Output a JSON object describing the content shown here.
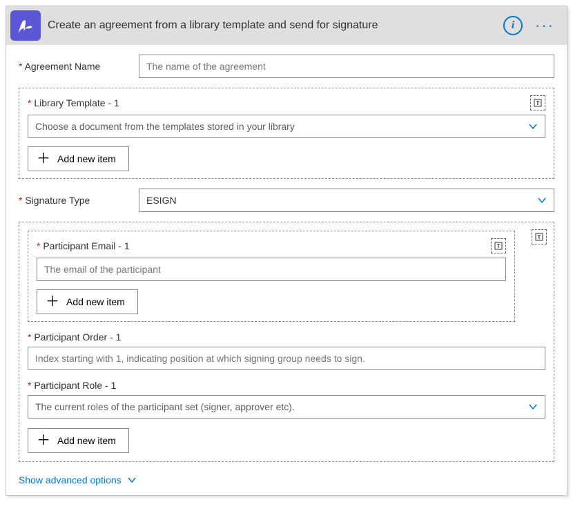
{
  "header": {
    "title": "Create an agreement from a library template and send for signature"
  },
  "fields": {
    "agreement_name": {
      "label": "Agreement Name",
      "placeholder": "The name of the agreement"
    },
    "library_template": {
      "label": "Library Template - 1",
      "placeholder": "Choose a document from the templates stored in your library",
      "add_label": "Add new item"
    },
    "signature_type": {
      "label": "Signature Type",
      "value": "ESIGN"
    },
    "participant_email": {
      "label": "Participant Email - 1",
      "placeholder": "The email of the participant",
      "add_label": "Add new item"
    },
    "participant_order": {
      "label": "Participant Order - 1",
      "placeholder": "Index starting with 1, indicating position at which signing group needs to sign."
    },
    "participant_role": {
      "label": "Participant Role - 1",
      "placeholder": "The current roles of the participant set (signer, approver etc)."
    },
    "participants_add_label": "Add new item"
  },
  "footer": {
    "advanced_label": "Show advanced options"
  }
}
